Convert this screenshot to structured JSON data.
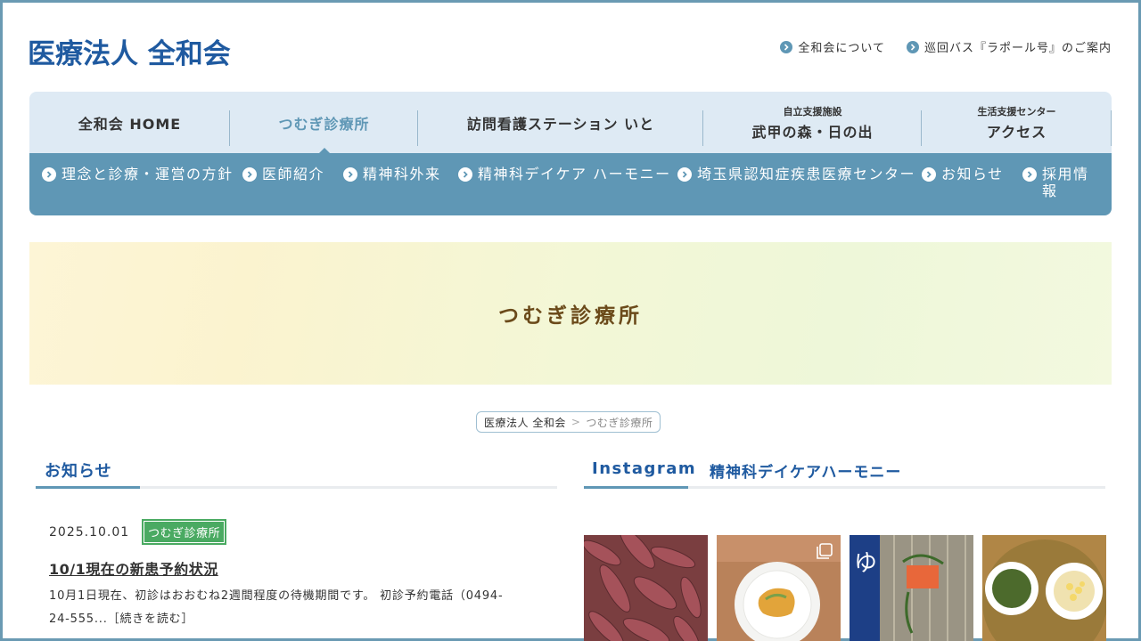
{
  "header": {
    "logo": "医療法人 全和会",
    "links": [
      {
        "label": "全和会について"
      },
      {
        "label": "巡回バス『ラポール号』のご案内"
      }
    ]
  },
  "nav": {
    "tabs": [
      {
        "label": "全和会 HOME",
        "small": ""
      },
      {
        "label": "つむぎ診療所",
        "small": "",
        "active": true
      },
      {
        "label": "訪問看護ステーション いと",
        "small": ""
      },
      {
        "label": "武甲の森・日の出",
        "small": "自立支援施設"
      },
      {
        "label": "アクセス",
        "small": "生活支援センター"
      }
    ],
    "sub": [
      {
        "label": "理念と診療・運営の方針"
      },
      {
        "label": "医師紹介"
      },
      {
        "label": "精神科外来"
      },
      {
        "label": "精神科デイケア ハーモニー"
      },
      {
        "label": "埼玉県認知症疾患医療センター"
      },
      {
        "label": "お知らせ"
      },
      {
        "label": "採用情報"
      }
    ]
  },
  "banner": {
    "title": "つむぎ診療所"
  },
  "breadcrumb": {
    "home": "医療法人 全和会",
    "sep": ">",
    "current": "つむぎ診療所"
  },
  "news": {
    "heading": "お知らせ",
    "items": [
      {
        "date": "2025.10.01",
        "tag": "つむぎ診療所",
        "title": "10/1現在の新患予約状況",
        "body": "10月1日現在、初診はおおむね2週間程度の待機期間です。 初診予約電話（0494-24-555...［続きを読む］"
      }
    ]
  },
  "instagram": {
    "heading": "Instagram",
    "subheading": "精神科デイケアハーモニー",
    "photos": [
      {
        "alt": "sweet-potatoes"
      },
      {
        "alt": "plate-food"
      },
      {
        "alt": "salon-door"
      },
      {
        "alt": "bowls"
      }
    ]
  },
  "colors": {
    "accent": "#5f97b5",
    "brand": "#1f5aa0",
    "tag": "#4aaa62",
    "nav_bg": "#deeaf4"
  }
}
